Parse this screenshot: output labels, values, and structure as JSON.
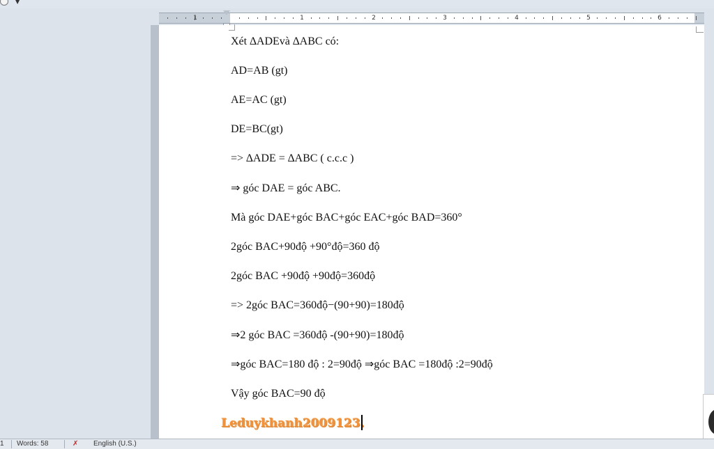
{
  "ruler": {
    "numbers": [
      "1",
      "1",
      "2",
      "3",
      "4",
      "5",
      "6"
    ]
  },
  "document": {
    "lines": [
      "Xét ∆ADEvà ∆ABC có:",
      "AD=AB (gt)",
      "AE=AC (gt)",
      " DE=BC(gt)",
      "=> ∆ADE = ∆ABC ( c.c.c )",
      "⇒ góc DAE = góc ABC.",
      "Mà góc DAE+góc BAC+góc EAC+góc BAD=360°",
      "2góc BAC+90độ +90°độ=360 độ",
      "2góc BAC +90độ +90độ=360độ",
      "=> 2góc BAC=360độ−(90+90)=180độ",
      "⇒2 góc BAC =360độ -(90+90)=180độ",
      "⇒góc BAC=180 độ : 2=90độ ⇒góc BAC =180độ :2=90độ",
      "Vậy góc BAC=90 độ"
    ],
    "signature": "Leduykhanh2009123."
  },
  "status_bar": {
    "page": "1",
    "words": "Words: 58",
    "language": "English (U.S.)"
  }
}
